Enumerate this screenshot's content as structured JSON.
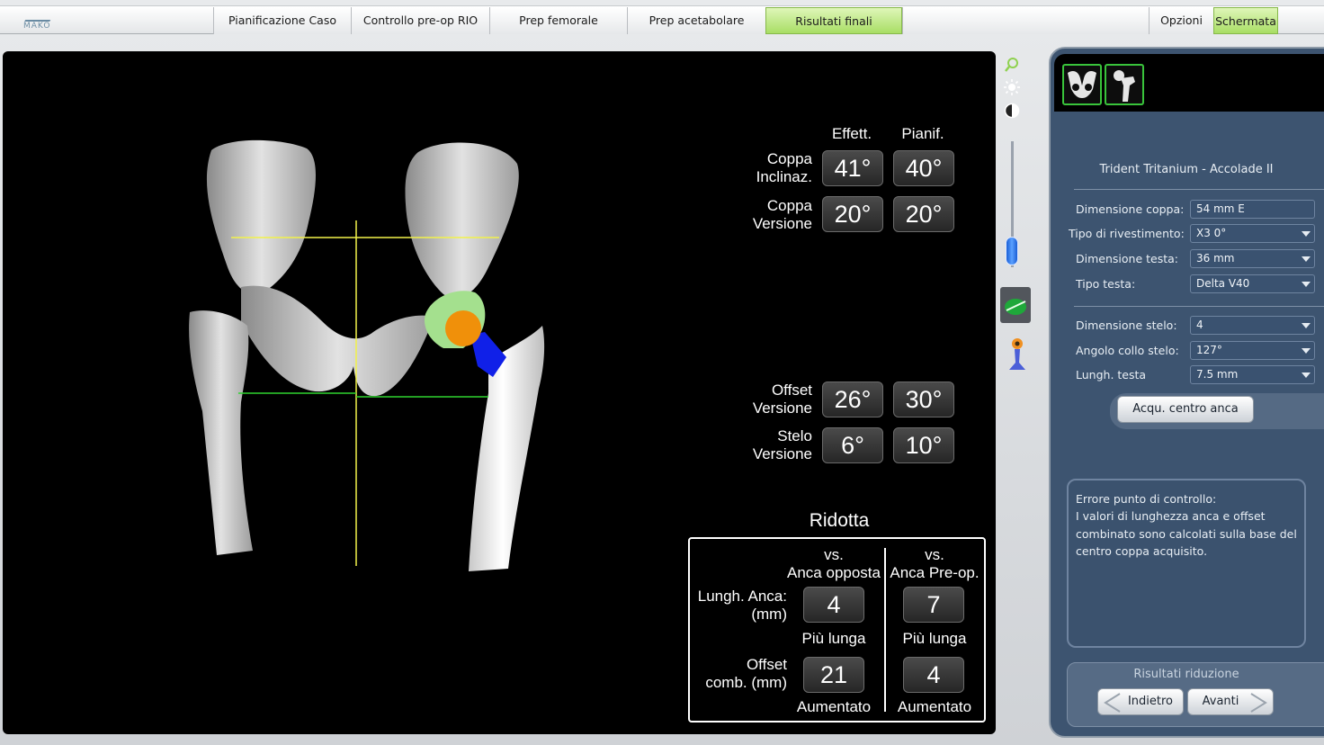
{
  "brand": {
    "logo_text": "MAKO"
  },
  "tabs": [
    {
      "label": "Pianificazione Caso"
    },
    {
      "label": "Controllo pre-op RIO"
    },
    {
      "label": "Prep femorale"
    },
    {
      "label": "Prep acetabolare"
    },
    {
      "label": "Risultati finali"
    }
  ],
  "right_tabs": {
    "options": "Opzioni",
    "screen": "Schermata"
  },
  "angles": {
    "header_actual": "Effett.",
    "header_planned": "Pianif.",
    "rows": [
      {
        "label1": "Coppa",
        "label2": "Inclinaz.",
        "actual": "41°",
        "planned": "40°"
      },
      {
        "label1": "Coppa",
        "label2": "Versione",
        "actual": "20°",
        "planned": "20°"
      },
      {
        "label1": "Offset",
        "label2": "Versione",
        "actual": "26°",
        "planned": "30°"
      },
      {
        "label1": "Stelo",
        "label2": "Versione",
        "actual": "6°",
        "planned": "10°"
      }
    ]
  },
  "reduction": {
    "title": "Ridotta",
    "col1_h1": "vs.",
    "col1_h2": "Anca opposta",
    "col2_h1": "vs.",
    "col2_h2": "Anca Pre-op.",
    "row1_l1": "Lungh. Anca:",
    "row1_l2": "(mm)",
    "row1_v1": "4",
    "row1_s1": "Più lunga",
    "row1_v2": "7",
    "row1_s2": "Più lunga",
    "row2_l1": "Offset",
    "row2_l2": "comb. (mm)",
    "row2_v1": "21",
    "row2_s1": "Aumentato",
    "row2_v2": "4",
    "row2_s2": "Aumentato"
  },
  "implant": {
    "name": "Trident Tritanium - Accolade II",
    "fields": [
      {
        "label": "Dimensione coppa:",
        "value": "54 mm E",
        "dropdown": false
      },
      {
        "label": "Tipo di rivestimento:",
        "value": "X3 0°",
        "dropdown": true
      },
      {
        "label": "Dimensione testa:",
        "value": "36 mm",
        "dropdown": true
      },
      {
        "label": "Tipo testa:",
        "value": "Delta V40",
        "dropdown": true
      },
      {
        "label": "Dimensione stelo:",
        "value": "4",
        "dropdown": true
      },
      {
        "label": "Angolo collo stelo:",
        "value": "127°",
        "dropdown": true
      },
      {
        "label": "Lungh. testa",
        "value": "7.5 mm",
        "dropdown": true
      }
    ],
    "acquire_button": "Acqu. centro anca"
  },
  "message": {
    "title": "Errore punto di controllo:",
    "body": "I valori di lunghezza anca e offset combinato sono calcolati sulla base del centro coppa acquisito."
  },
  "footer": {
    "title": "Risultati riduzione",
    "back": "Indietro",
    "next": "Avanti"
  },
  "colors": {
    "active_tab": "#a8de64",
    "panel": "#3d5470",
    "bone": "#d8d8d8",
    "cup_green": "#9be08a",
    "head_orange": "#f0900a",
    "neck_blue": "#1020e8",
    "guide_yellow": "#f2f24a",
    "guide_green": "#2fd42f"
  }
}
